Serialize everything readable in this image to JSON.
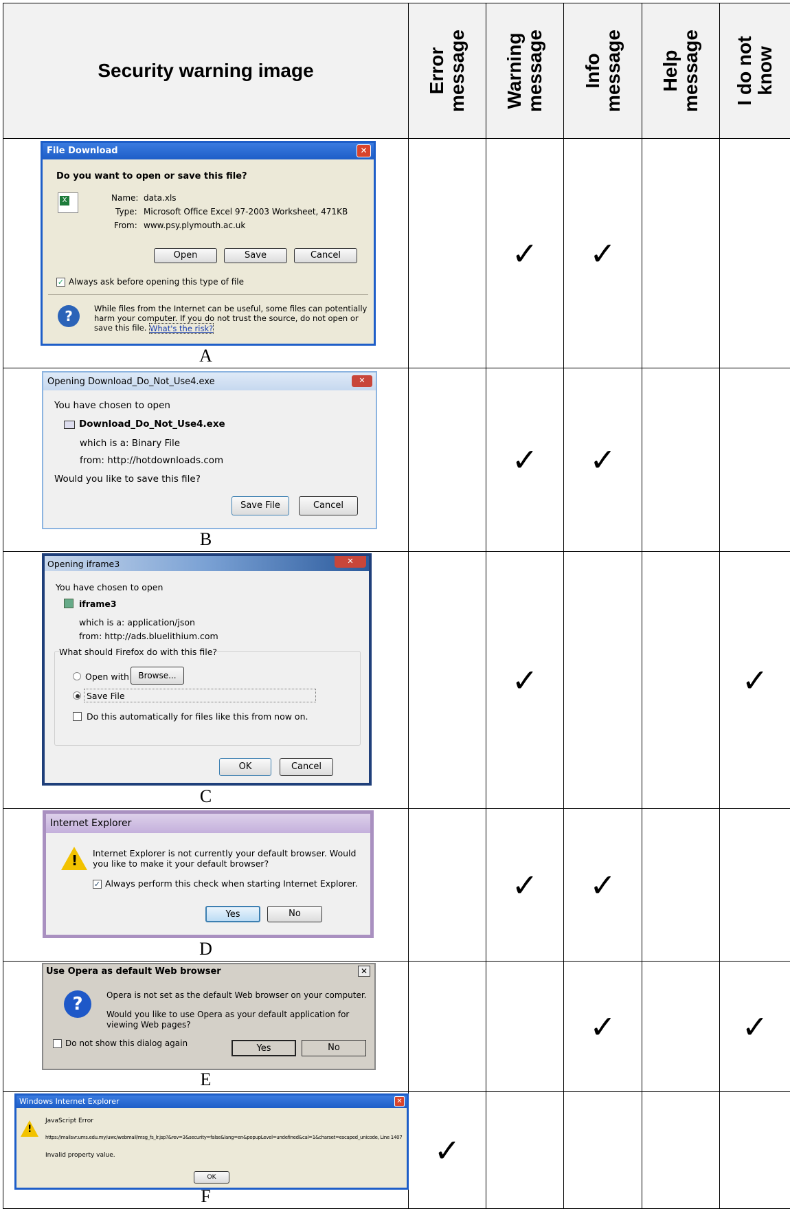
{
  "header": {
    "image_col": "Security warning image",
    "error_line1": "Error",
    "error_line2": "message",
    "warning_line1": "Warning",
    "warning_line2": "message",
    "info_line1": "Info",
    "info_line2": "message",
    "help_line1": "Help",
    "help_line2": "message",
    "idk_line1": "I do not",
    "idk_line2": "know"
  },
  "check_symbol": "✓",
  "rows": [
    {
      "letter": "A",
      "checks": {
        "error": false,
        "warning": true,
        "info": true,
        "help": false,
        "idk": false
      }
    },
    {
      "letter": "B",
      "checks": {
        "error": false,
        "warning": true,
        "info": true,
        "help": false,
        "idk": false
      }
    },
    {
      "letter": "C",
      "checks": {
        "error": false,
        "warning": true,
        "info": false,
        "help": false,
        "idk": true
      }
    },
    {
      "letter": "D",
      "checks": {
        "error": false,
        "warning": true,
        "info": true,
        "help": false,
        "idk": false
      }
    },
    {
      "letter": "E",
      "checks": {
        "error": false,
        "warning": false,
        "info": true,
        "help": false,
        "idk": true
      }
    },
    {
      "letter": "F",
      "checks": {
        "error": true,
        "warning": false,
        "info": false,
        "help": false,
        "idk": false
      }
    }
  ],
  "dialog_a": {
    "title": "File Download",
    "question": "Do you want to open or save this file?",
    "name_label": "Name:",
    "name_value": "data.xls",
    "type_label": "Type:",
    "type_value": "Microsoft Office Excel 97-2003 Worksheet, 471KB",
    "from_label": "From:",
    "from_value": "www.psy.plymouth.ac.uk",
    "open_btn": "Open",
    "save_btn": "Save",
    "cancel_btn": "Cancel",
    "checkbox": "Always ask before opening this type of file",
    "warning_line1": "While files from the Internet can be useful, some files can potentially",
    "warning_line2": "harm your computer. If you do not trust the source, do not open or",
    "warning_line3": "save this file.",
    "risk_link": "What's the risk?"
  },
  "dialog_b": {
    "title": "Opening Download_Do_Not_Use4.exe",
    "chosen": "You have chosen to open",
    "filename": "Download_Do_Not_Use4.exe",
    "which_is": "which is a:  Binary File",
    "from": "from:  http://hotdownloads.com",
    "question": "Would you like to save this file?",
    "save_btn": "Save File",
    "cancel_btn": "Cancel"
  },
  "dialog_c": {
    "title": "Opening iframe3",
    "chosen": "You have chosen to open",
    "filename": "iframe3",
    "which_is": "which is a:  application/json",
    "from": "from:  http://ads.bluelithium.com",
    "question": "What should Firefox do with this file?",
    "open_with": "Open with",
    "browse_btn": "Browse...",
    "save_file": "Save File",
    "auto": "Do this automatically for files like this from now on.",
    "ok_btn": "OK",
    "cancel_btn": "Cancel"
  },
  "dialog_d": {
    "title": "Internet Explorer",
    "msg_line1": "Internet Explorer is not currently your default browser. Would",
    "msg_line2": "you like to make it your default browser?",
    "checkbox": "Always perform this check when starting Internet Explorer.",
    "yes_btn": "Yes",
    "no_btn": "No"
  },
  "dialog_e": {
    "title": "Use Opera as default Web browser",
    "msg1": "Opera is not set as the default Web browser on your computer.",
    "msg2_line1": "Would you like to use Opera as your default application for",
    "msg2_line2": "viewing Web pages?",
    "checkbox": "Do not show this dialog again",
    "yes_btn": "Yes",
    "no_btn": "No"
  },
  "dialog_f": {
    "title": "Windows Internet Explorer",
    "err_title": "JavaScript Error",
    "url": "https://mailsvr.ums.edu.my/uwc/webmail/msg_fs_lr.jsp?&rev=3&security=false&lang=en&popupLevel=undefined&cal=1&charset=escaped_unicode, Line 1407",
    "detail": "Invalid property value.",
    "ok_btn": "OK"
  },
  "colors": {
    "header_bg": "#f2f2f2",
    "xp_title": "#1e5ec8",
    "xp_body": "#ece9d8",
    "vista_body": "#f0f0f0",
    "close_red": "#d9442c"
  }
}
